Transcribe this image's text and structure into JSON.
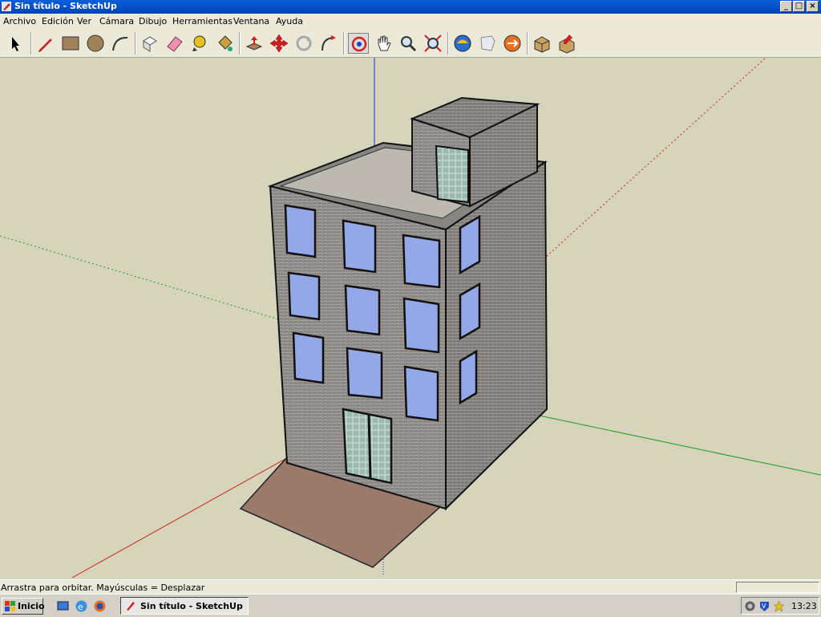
{
  "window": {
    "title": "Sin título - SketchUp",
    "app_icon": "sketchup-pencil-icon"
  },
  "window_controls": {
    "minimize": "_",
    "maximize": "□",
    "close": "×"
  },
  "menu": [
    "Archivo",
    "Edición",
    "Ver",
    "Cámara",
    "Dibujo",
    "Herramientas",
    "Ventana",
    "Ayuda"
  ],
  "toolbar": {
    "tools": [
      "select-arrow-icon",
      "pencil-line-icon",
      "rectangle-icon",
      "circle-icon",
      "arc-icon",
      "make-component-icon",
      "eraser-icon",
      "tape-measure-icon",
      "paint-bucket-icon",
      "push-pull-icon",
      "move-icon",
      "rotate-icon",
      "follow-me-icon",
      "orbit-icon",
      "pan-hand-icon",
      "zoom-icon",
      "zoom-extents-icon",
      "3d-warehouse-icon",
      "get-models-icon",
      "share-model-icon",
      "component-icon",
      "place-component-icon"
    ],
    "active_tool": "orbit-icon"
  },
  "viewport": {
    "axis_colors": {
      "red": "#cc2020",
      "green": "#1f9d1f",
      "blue": "#1f2fd6"
    },
    "background": "#d6d4bb",
    "model": "building"
  },
  "status": {
    "message": "Arrastra para orbitar.  Mayúsculas = Desplazar",
    "vcb_value": ""
  },
  "taskbar": {
    "start_label": "Inicio",
    "quicklaunch": [
      "desktop-icon",
      "internet-explorer-icon",
      "firefox-icon"
    ],
    "task_label": "Sin título - SketchUp",
    "tray_icons": [
      "network-icon",
      "antivirus-icon",
      "messenger-icon"
    ],
    "clock": "13:23"
  }
}
